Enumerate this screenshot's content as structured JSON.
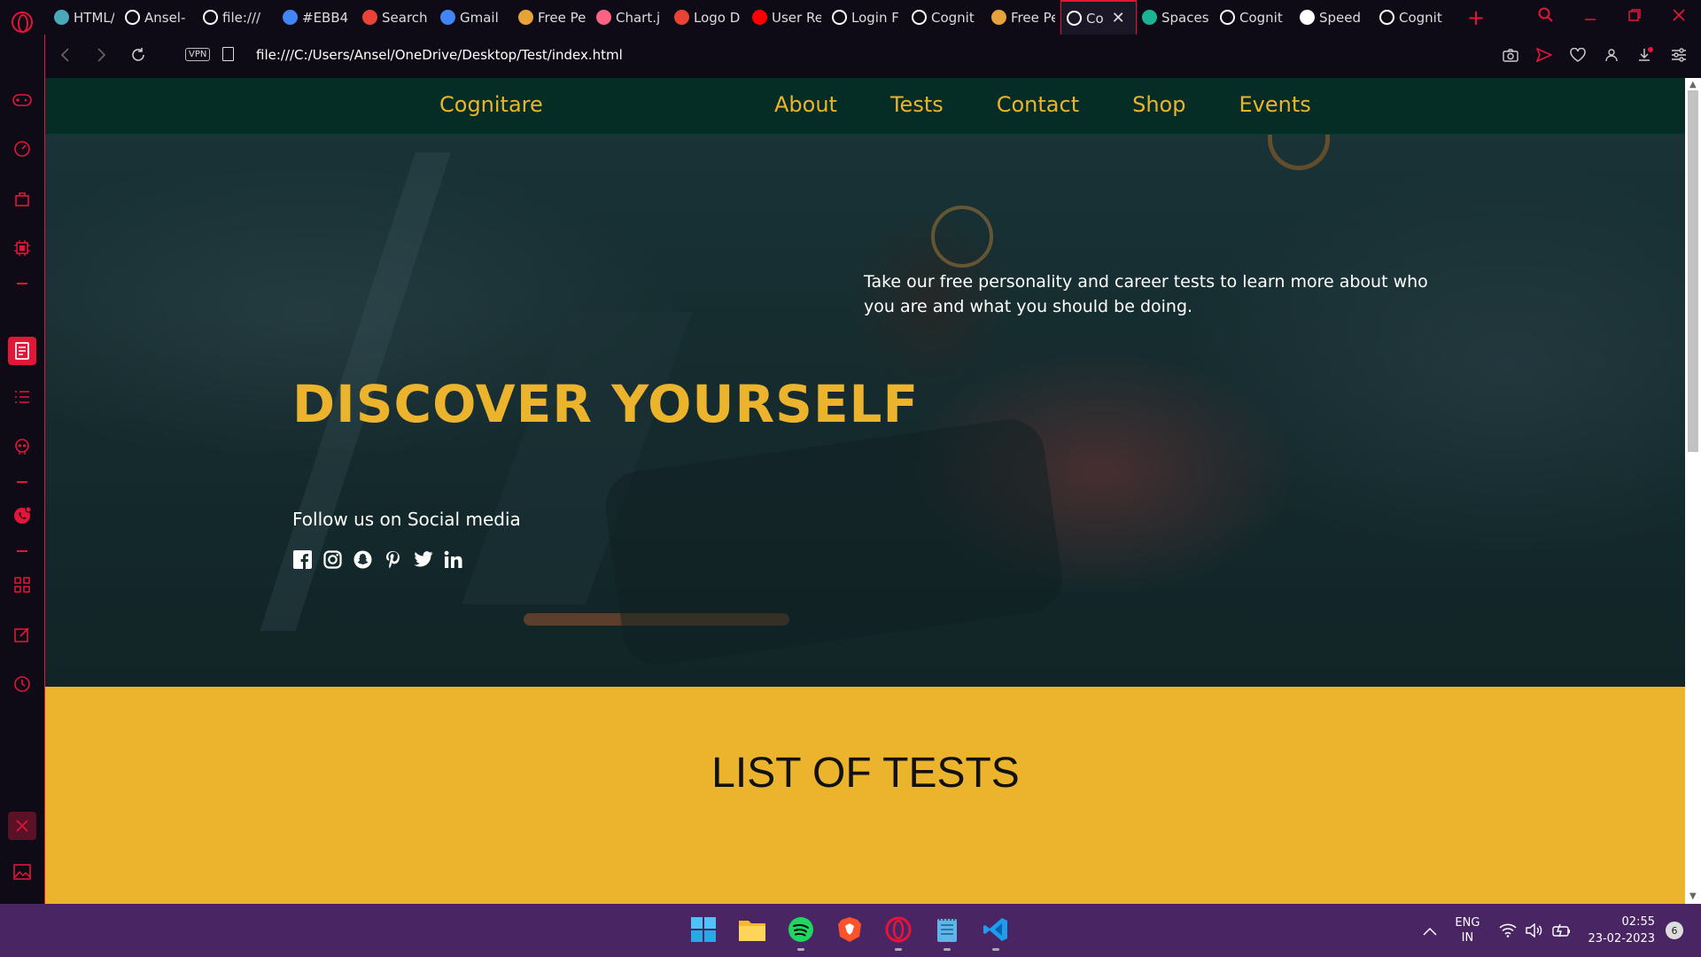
{
  "browser": {
    "tabs": [
      {
        "title": "HTML/",
        "favicon": "code-icon",
        "color": "#4aa8b8"
      },
      {
        "title": "Ansel-",
        "favicon": "github-icon",
        "color": "#ffffff"
      },
      {
        "title": "file:///",
        "favicon": "globe-icon",
        "color": "#ffffff"
      },
      {
        "title": "#EBB4",
        "favicon": "google-icon",
        "color": "#4285f4"
      },
      {
        "title": "Search",
        "favicon": "gmail-icon",
        "color": "#ea4335"
      },
      {
        "title": "Gmail",
        "favicon": "google-icon",
        "color": "#4285f4"
      },
      {
        "title": "Free Pe",
        "favicon": "t-icon",
        "color": "#e8a23a"
      },
      {
        "title": "Chart.j",
        "favicon": "chart-icon",
        "color": "#ff6384"
      },
      {
        "title": "Logo D",
        "favicon": "gmail-icon",
        "color": "#ea4335"
      },
      {
        "title": "User Re",
        "favicon": "youtube-icon",
        "color": "#ff0000"
      },
      {
        "title": "Login F",
        "favicon": "globe-icon",
        "color": "#ffffff"
      },
      {
        "title": "Cognit",
        "favicon": "globe-icon",
        "color": "#ffffff"
      },
      {
        "title": "Free Pe",
        "favicon": "t-icon",
        "color": "#e8a23a"
      },
      {
        "title": "Co",
        "favicon": "globe-icon",
        "color": "#ffffff",
        "active": true
      },
      {
        "title": "Spaces",
        "favicon": "w-icon",
        "color": "#1bb394"
      },
      {
        "title": "Cognit",
        "favicon": "globe-icon",
        "color": "#ffffff"
      },
      {
        "title": "Speed",
        "favicon": "grid-icon",
        "color": "#ffffff"
      },
      {
        "title": "Cognit",
        "favicon": "globe-icon",
        "color": "#ffffff"
      }
    ],
    "url": "file:///C:/Users/Ansel/OneDrive/Desktop/Test/index.html",
    "vpn_label": "VPN",
    "accent": "#e3163a"
  },
  "site": {
    "brand": "Cognitare",
    "nav": [
      "About",
      "Tests",
      "Contact",
      "Shop",
      "Events"
    ],
    "hero_title": "DISCOVER YOURSELF",
    "hero_description": "Take our free personality and career tests to learn more about who you are and what you should be doing.",
    "follow_text": "Follow us on Social media",
    "social": [
      "facebook-icon",
      "instagram-icon",
      "snapchat-icon",
      "pinterest-icon",
      "twitter-icon",
      "linkedin-icon"
    ],
    "tests_heading": "LIST OF TESTS",
    "colors": {
      "accent": "#ebb42c",
      "nav_bg": "#052c25"
    }
  },
  "taskbar": {
    "apps": [
      "windows-start-icon",
      "file-explorer-icon",
      "spotify-icon",
      "brave-icon",
      "opera-icon",
      "notepad-icon",
      "vscode-icon"
    ],
    "lang_line1": "ENG",
    "lang_line2": "IN",
    "time": "02:55",
    "date": "23-02-2023",
    "notifications": "6"
  }
}
